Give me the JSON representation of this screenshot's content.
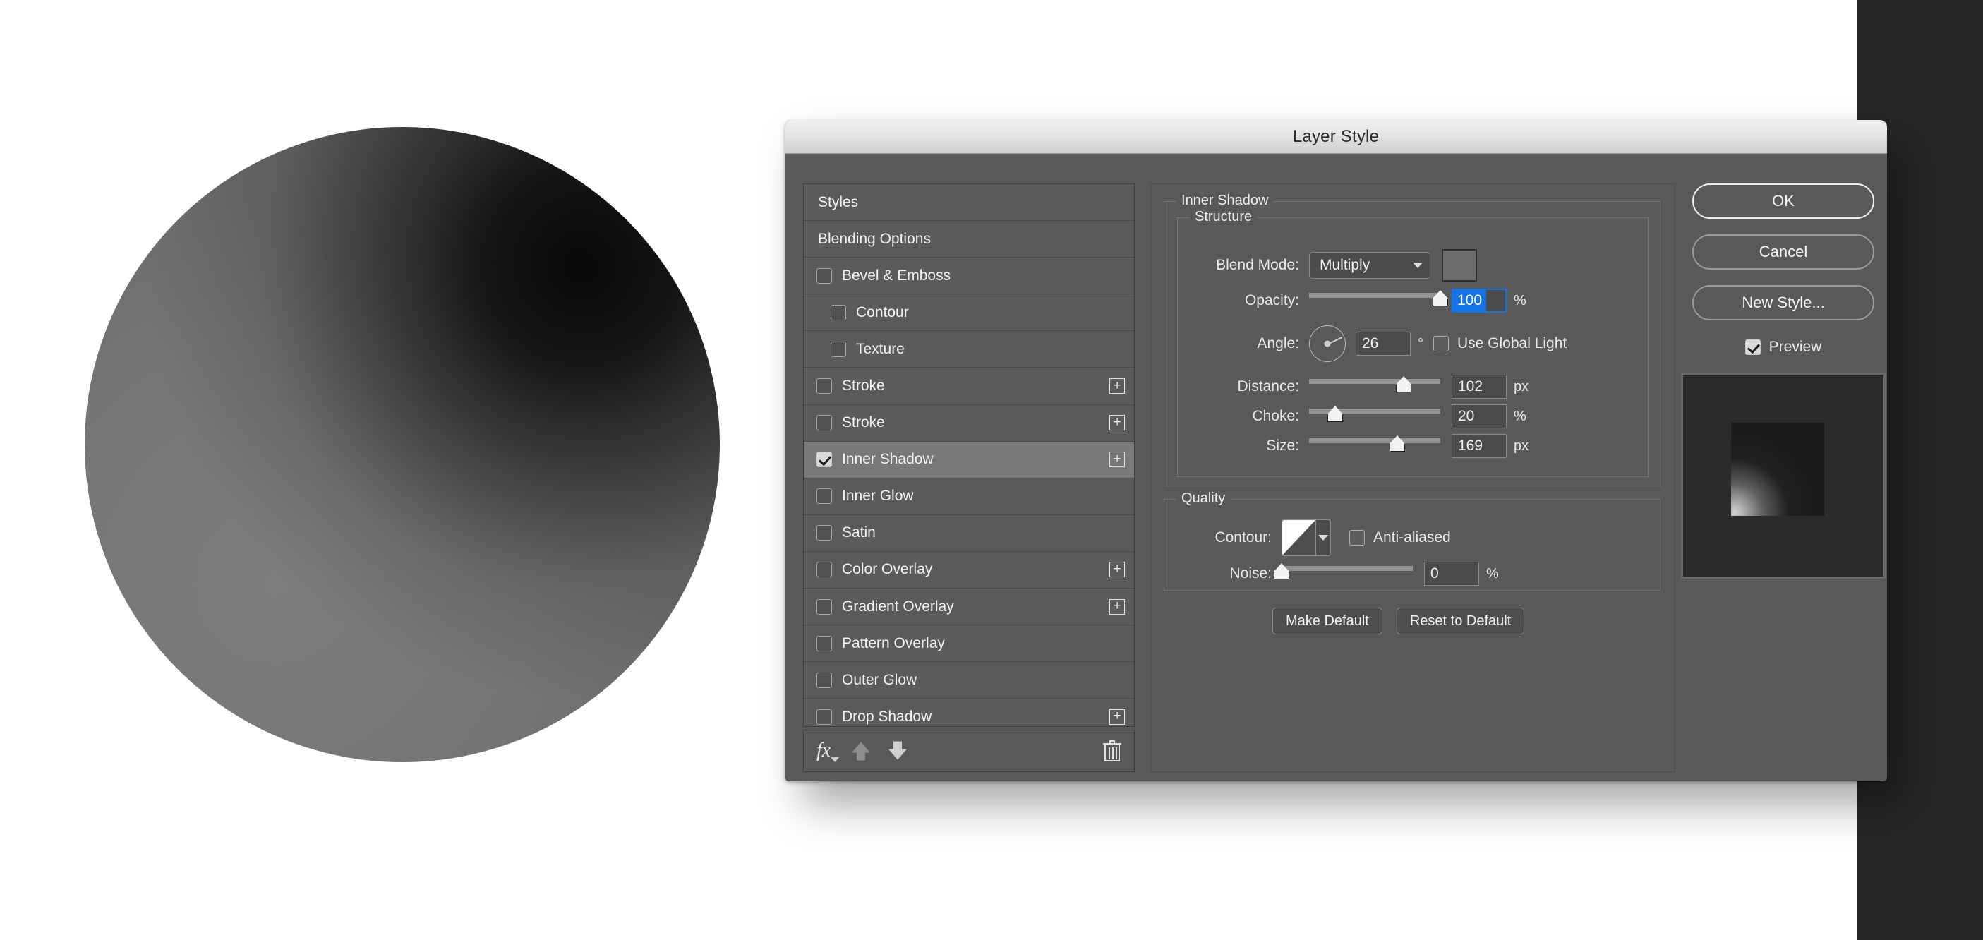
{
  "dialog": {
    "title": "Layer Style"
  },
  "styles_list": {
    "items": [
      {
        "label": "Styles",
        "checkbox": false,
        "checked": false,
        "indent": false,
        "plus": false,
        "selected": false
      },
      {
        "label": "Blending Options",
        "checkbox": false,
        "checked": false,
        "indent": false,
        "plus": false,
        "selected": false
      },
      {
        "label": "Bevel & Emboss",
        "checkbox": true,
        "checked": false,
        "indent": false,
        "plus": false,
        "selected": false
      },
      {
        "label": "Contour",
        "checkbox": true,
        "checked": false,
        "indent": true,
        "plus": false,
        "selected": false
      },
      {
        "label": "Texture",
        "checkbox": true,
        "checked": false,
        "indent": true,
        "plus": false,
        "selected": false
      },
      {
        "label": "Stroke",
        "checkbox": true,
        "checked": false,
        "indent": false,
        "plus": true,
        "selected": false
      },
      {
        "label": "Stroke",
        "checkbox": true,
        "checked": false,
        "indent": false,
        "plus": true,
        "selected": false
      },
      {
        "label": "Inner Shadow",
        "checkbox": true,
        "checked": true,
        "indent": false,
        "plus": true,
        "selected": true
      },
      {
        "label": "Inner Glow",
        "checkbox": true,
        "checked": false,
        "indent": false,
        "plus": false,
        "selected": false
      },
      {
        "label": "Satin",
        "checkbox": true,
        "checked": false,
        "indent": false,
        "plus": false,
        "selected": false
      },
      {
        "label": "Color Overlay",
        "checkbox": true,
        "checked": false,
        "indent": false,
        "plus": true,
        "selected": false
      },
      {
        "label": "Gradient Overlay",
        "checkbox": true,
        "checked": false,
        "indent": false,
        "plus": true,
        "selected": false
      },
      {
        "label": "Pattern Overlay",
        "checkbox": true,
        "checked": false,
        "indent": false,
        "plus": false,
        "selected": false
      },
      {
        "label": "Outer Glow",
        "checkbox": true,
        "checked": false,
        "indent": false,
        "plus": false,
        "selected": false
      },
      {
        "label": "Drop Shadow",
        "checkbox": true,
        "checked": false,
        "indent": false,
        "plus": true,
        "selected": false
      }
    ],
    "plus_glyph": "+",
    "footer": {
      "fx_label": "fx",
      "move_up_icon": "arrow-up-icon",
      "move_down_icon": "arrow-down-icon",
      "delete_icon": "trash-icon"
    }
  },
  "settings": {
    "section_title": "Inner Shadow",
    "structure": {
      "legend": "Structure",
      "blend_mode": {
        "label": "Blend Mode:",
        "value": "Multiply"
      },
      "color_swatch": "#6d6d6d",
      "opacity": {
        "label": "Opacity:",
        "value": "100",
        "unit": "%",
        "slider_pct": 100,
        "focused": true
      },
      "angle": {
        "label": "Angle:",
        "value": "26",
        "unit": "°",
        "degrees": 26
      },
      "use_global_light": {
        "label": "Use Global Light",
        "checked": false
      },
      "distance": {
        "label": "Distance:",
        "value": "102",
        "unit": "px",
        "slider_pct": 72
      },
      "choke": {
        "label": "Choke:",
        "value": "20",
        "unit": "%",
        "slider_pct": 20
      },
      "size": {
        "label": "Size:",
        "value": "169",
        "unit": "px",
        "slider_pct": 67
      }
    },
    "quality": {
      "legend": "Quality",
      "contour": {
        "label": "Contour:",
        "swatch": "linear-contour"
      },
      "anti_aliased": {
        "label": "Anti-aliased",
        "checked": false
      },
      "noise": {
        "label": "Noise:",
        "value": "0",
        "unit": "%",
        "slider_pct": 0
      }
    },
    "buttons": {
      "make_default": "Make Default",
      "reset_to_default": "Reset to Default"
    }
  },
  "actions": {
    "ok": "OK",
    "cancel": "Cancel",
    "new_style": "New Style...",
    "preview": {
      "label": "Preview",
      "checked": true
    }
  },
  "colors": {
    "dialog_bg": "#595959",
    "titlebar_top": "#f0f0f0",
    "selection_blue": "#1473e6",
    "selected_row": "#787878",
    "canvas_bg": "#ffffff",
    "right_panel": "#262626"
  }
}
